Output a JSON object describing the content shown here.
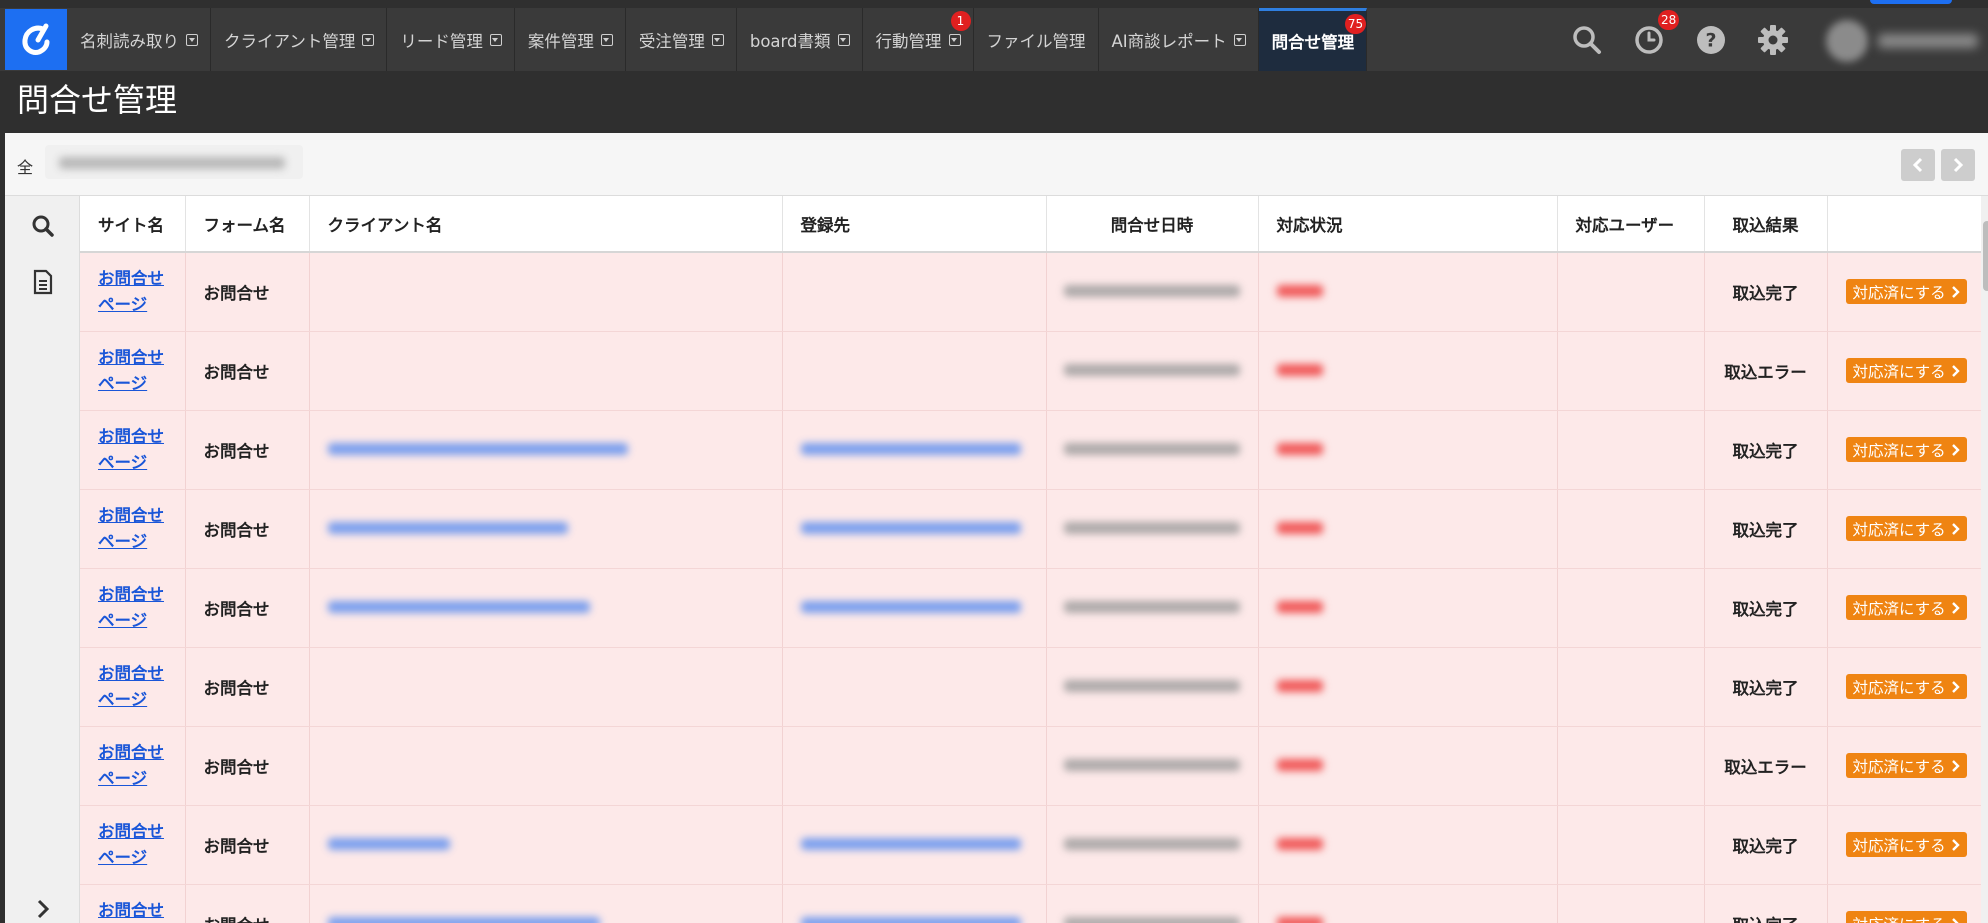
{
  "nav": {
    "tabs": [
      {
        "label": "名刺読み取り",
        "dropdown": true
      },
      {
        "label": "クライアント管理",
        "dropdown": true
      },
      {
        "label": "リード管理",
        "dropdown": true
      },
      {
        "label": "案件管理",
        "dropdown": true
      },
      {
        "label": "受注管理",
        "dropdown": true
      },
      {
        "label": "board書類",
        "dropdown": true
      },
      {
        "label": "行動管理",
        "dropdown": true,
        "badge": "1"
      },
      {
        "label": "ファイル管理",
        "dropdown": false
      },
      {
        "label": "AI商談レポート",
        "dropdown": true
      },
      {
        "label": "問合せ管理",
        "dropdown": false,
        "badge": "75",
        "active": true
      }
    ],
    "icons": [
      "search-icon",
      "history-icon",
      "help-icon",
      "settings-icon"
    ],
    "history_badge": "28"
  },
  "page": {
    "title": "問合せ管理"
  },
  "filter": {
    "prefix": "全"
  },
  "table": {
    "headers": {
      "site": "サイト名",
      "form": "フォーム名",
      "client": "クライアント名",
      "registered_to": "登録先",
      "inquiry_datetime": "問合せ日時",
      "status": "対応状況",
      "user": "対応ユーザー",
      "result": "取込結果"
    },
    "rows": [
      {
        "site": "お問合せページ",
        "form": "お問合せ",
        "has_client": false,
        "result": "取込完了",
        "action": "対応済にする"
      },
      {
        "site": "お問合せページ",
        "form": "お問合せ",
        "has_client": false,
        "result": "取込エラー",
        "action": "対応済にする"
      },
      {
        "site": "お問合せページ",
        "form": "お問合せ",
        "has_client": true,
        "result": "取込完了",
        "action": "対応済にする"
      },
      {
        "site": "お問合せページ",
        "form": "お問合せ",
        "has_client": true,
        "result": "取込完了",
        "action": "対応済にする"
      },
      {
        "site": "お問合せページ",
        "form": "お問合せ",
        "has_client": true,
        "result": "取込完了",
        "action": "対応済にする"
      },
      {
        "site": "お問合せページ",
        "form": "お問合せ",
        "has_client": false,
        "result": "取込完了",
        "action": "対応済にする"
      },
      {
        "site": "お問合せページ",
        "form": "お問合せ",
        "has_client": false,
        "result": "取込エラー",
        "action": "対応済にする"
      },
      {
        "site": "お問合せページ",
        "form": "お問合せ",
        "has_client": true,
        "result": "取込完了",
        "action": "対応済にする"
      },
      {
        "site": "お問合せページ",
        "form": "お問合せ",
        "has_client": true,
        "result": "取込完了",
        "action": "対応済にする"
      }
    ]
  },
  "colors": {
    "accent": "#1d6ff2",
    "action": "#ef8412",
    "row_bg": "#fde9e9",
    "badge": "#e02020",
    "link": "#1a56d8"
  }
}
